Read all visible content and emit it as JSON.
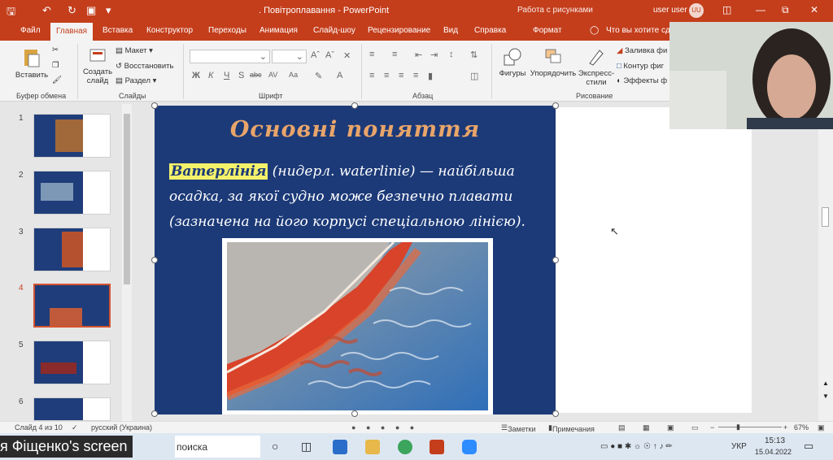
{
  "titlebar": {
    "doc_title": ". Повітроплавання  -  PowerPoint",
    "context_tab": "Работа с рисунками",
    "user": "user user",
    "avatar": "UU"
  },
  "tabs": [
    "Файл",
    "Главная",
    "Вставка",
    "Конструктор",
    "Переходы",
    "Анимация",
    "Слайд-шоу",
    "Рецензирование",
    "Вид",
    "Справка",
    "Формат"
  ],
  "tell_me": "Что вы хотите сде",
  "ribbon": {
    "clipboard": {
      "paste": "Вставить",
      "label": "Буфер обмена"
    },
    "slides": {
      "new_slide": "Создать слайд",
      "layout": "Макет",
      "reset": "Восстановить",
      "section": "Раздел",
      "label": "Слайды"
    },
    "font": {
      "label": "Шрифт",
      "bold": "Ж",
      "italic": "К",
      "underline": "Ч",
      "strike": "S",
      "spacing": "abc",
      "font_size": "Аа"
    },
    "paragraph": {
      "label": "Абзац"
    },
    "drawing": {
      "shapes": "Фигуры",
      "arrange": "Упорядочить",
      "quick_styles": "Экспресс-стили",
      "fill": "Заливка фи",
      "outline": "Контур фиг",
      "effects": "Эффекты ф",
      "label": "Рисование"
    }
  },
  "thumbnails": [
    {
      "num": "1"
    },
    {
      "num": "2"
    },
    {
      "num": "3"
    },
    {
      "num": "4",
      "selected": true
    },
    {
      "num": "5"
    },
    {
      "num": "6"
    }
  ],
  "slide": {
    "title": "Основні поняття",
    "term": "Ватерлінія",
    "body": " (нидерл. waterlinie) — найбільша осадка, за якої судно може безпечно плавати (зазначена на його корпусі спеціальною лінією)."
  },
  "status": {
    "slide_info": "Слайд 4 из 10",
    "language": "русский (Украина)",
    "notes": "Заметки",
    "comments": "Примечания",
    "zoom": "67%"
  },
  "taskbar": {
    "screen_label": "я Фіщенко's screen",
    "search": "поиска",
    "lang": "УКР",
    "time": "15:13",
    "date": "15.04.2022"
  }
}
